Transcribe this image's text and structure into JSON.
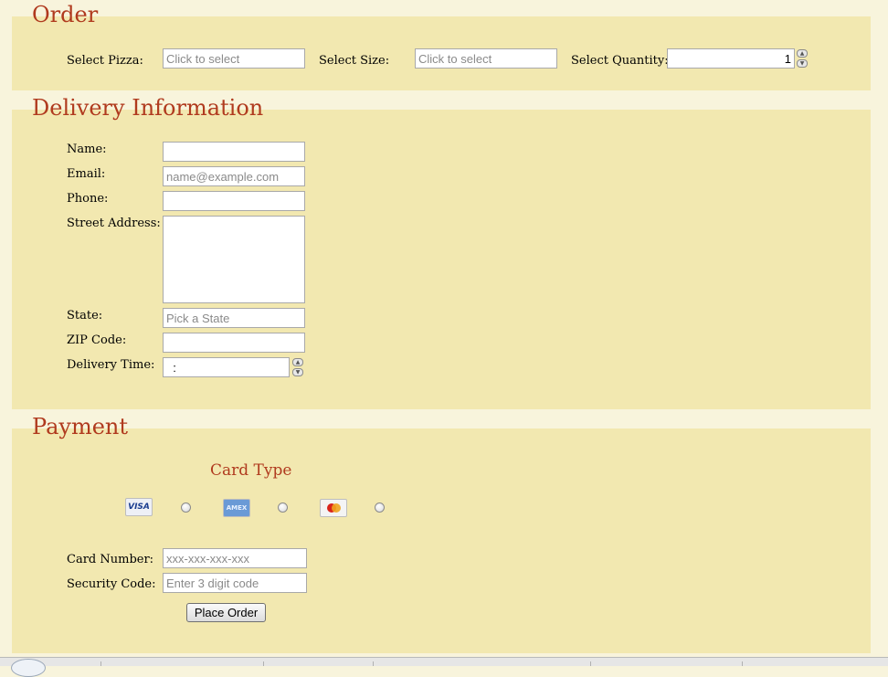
{
  "order": {
    "legend": "Order",
    "pizza_label": "Select Pizza:",
    "pizza_placeholder": "Click to select",
    "size_label": "Select Size:",
    "size_placeholder": "Click to select",
    "quantity_label": "Select Quantity:",
    "quantity_value": "1"
  },
  "delivery": {
    "legend": "Delivery Information",
    "name_label": "Name:",
    "email_label": "Email:",
    "email_placeholder": "name@example.com",
    "phone_label": "Phone:",
    "street_label": "Street Address:",
    "state_label": "State:",
    "state_placeholder": "Pick a State",
    "zip_label": "ZIP Code:",
    "time_label": "Delivery Time:",
    "time_value": "  :"
  },
  "payment": {
    "legend": "Payment",
    "card_type_label": "Card Type",
    "cards": [
      {
        "name": "VISA",
        "icon": "visa-logo-icon"
      },
      {
        "name": "AMEX",
        "icon": "amex-logo-icon"
      },
      {
        "name": "MasterCard",
        "icon": "mastercard-logo-icon"
      }
    ],
    "card_number_label": "Card Number:",
    "card_number_placeholder": "xxx-xxx-xxx-xxx",
    "security_label": "Security Code:",
    "security_placeholder": "Enter 3 digit code",
    "submit_label": "Place Order"
  },
  "colors": {
    "page_bg": "#f8f4dc",
    "fieldset_bg": "#f2e8b0",
    "legend_text": "#b03a1e"
  }
}
